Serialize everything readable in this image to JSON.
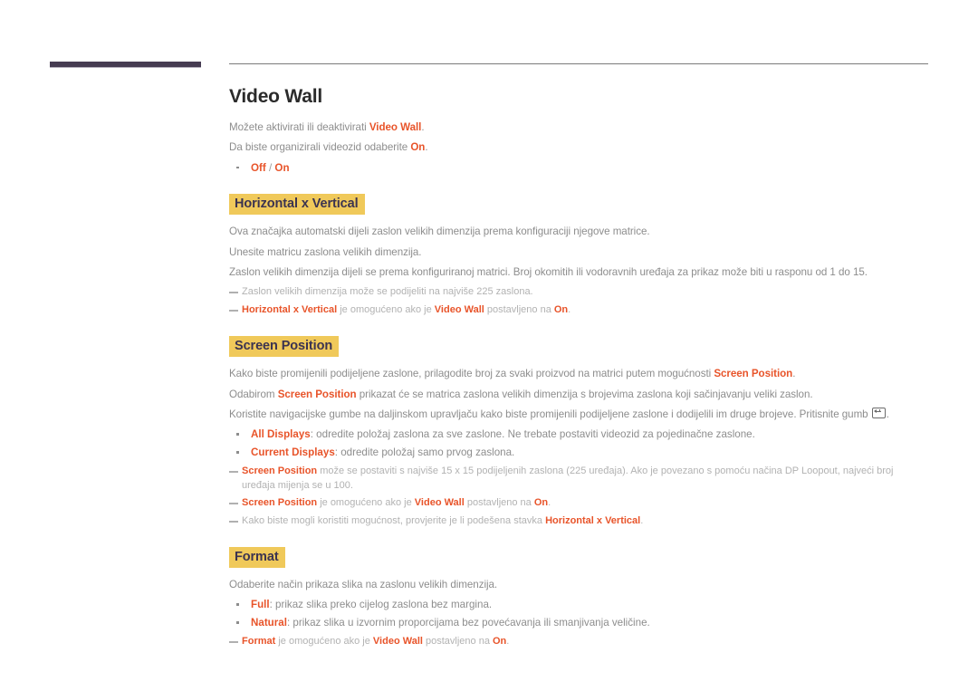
{
  "page": {
    "title": "Video Wall",
    "language": "hr"
  },
  "colors": {
    "tab_bar": "#463c52",
    "highlight": "#f0c95a",
    "keyword": "#e8542a",
    "body_text": "#8d8d8d",
    "note_text": "#b2b2b2",
    "title_text": "#2b2b2b",
    "rule": "#7b7b7b"
  },
  "sections": [
    {
      "id": "video-wall",
      "is_page_title": true,
      "heading": "Video Wall",
      "paragraphs": [
        {
          "pre": "Možete aktivirati ili deaktivirati ",
          "kw": "Video Wall",
          "post": "."
        },
        {
          "pre": "Da biste organizirali videozid odaberite ",
          "kw": "On",
          "post": "."
        }
      ],
      "options": [
        {
          "kw": "Off",
          "sep": " / ",
          "kw2": "On",
          "desc": ""
        }
      ],
      "notes": []
    },
    {
      "id": "horizontal-x-vertical",
      "is_page_title": false,
      "heading": "Horizontal x Vertical",
      "paragraphs": [
        {
          "pre": "Ova značajka automatski dijeli zaslon velikih dimenzija prema konfiguraciji njegove matrice.",
          "kw": "",
          "post": ""
        },
        {
          "pre": "Unesite matricu zaslona velikih dimenzija.",
          "kw": "",
          "post": ""
        },
        {
          "pre": "Zaslon velikih dimenzija dijeli se prema konfiguriranoj matrici. Broj okomitih ili vodoravnih uređaja za prikaz može biti u rasponu od 1 do 15.",
          "kw": "",
          "post": ""
        }
      ],
      "options": [],
      "notes": [
        {
          "parts": [
            {
              "t": "Zaslon velikih dimenzija može se podijeliti na najviše 225 zaslona.",
              "k": false
            }
          ]
        },
        {
          "parts": [
            {
              "t": "Horizontal x Vertical",
              "k": true
            },
            {
              "t": " je omogućeno ako je ",
              "k": false
            },
            {
              "t": "Video Wall",
              "k": true
            },
            {
              "t": " postavljeno na ",
              "k": false
            },
            {
              "t": "On",
              "k": true
            },
            {
              "t": ".",
              "k": false
            }
          ]
        }
      ]
    },
    {
      "id": "screen-position",
      "is_page_title": false,
      "heading": "Screen Position",
      "paragraphs": [
        {
          "pre": "Kako biste promijenili podijeljene zaslone, prilagodite broj za svaki proizvod na matrici putem mogućnosti ",
          "kw": "Screen Position",
          "post": "."
        },
        {
          "pre": "Odabirom ",
          "kw": "Screen Position",
          "post": " prikazat će se matrica zaslona velikih dimenzija s brojevima zaslona koji sačinjavanju veliki zaslon."
        },
        {
          "pre": "Koristite navigacijske gumbe na daljinskom upravljaču kako biste promijenili podijeljene zaslone i dodijelili im druge brojeve. Pritisnite gumb ",
          "kw": "",
          "post": ".",
          "enter_key": true
        }
      ],
      "options": [
        {
          "kw": "All Displays",
          "sep": "",
          "kw2": "",
          "desc": ": odredite položaj zaslona za sve zaslone. Ne trebate postaviti videozid za pojedinačne zaslone."
        },
        {
          "kw": "Current Displays",
          "sep": "",
          "kw2": "",
          "desc": ": odredite položaj samo prvog zaslona."
        }
      ],
      "notes": [
        {
          "parts": [
            {
              "t": "Screen Position",
              "k": true
            },
            {
              "t": " može se postaviti s najviše 15 x 15 podijeljenih zaslona (225 uređaja). Ako je povezano s pomoću načina DP Loopout, najveći broj uređaja mijenja se u 100.",
              "k": false
            }
          ]
        },
        {
          "parts": [
            {
              "t": "Screen Position",
              "k": true
            },
            {
              "t": " je omogućeno ako je ",
              "k": false
            },
            {
              "t": "Video Wall",
              "k": true
            },
            {
              "t": " postavljeno na ",
              "k": false
            },
            {
              "t": "On",
              "k": true
            },
            {
              "t": ".",
              "k": false
            }
          ]
        },
        {
          "parts": [
            {
              "t": "Kako biste mogli koristiti mogućnost, provjerite je li podešena stavka ",
              "k": false
            },
            {
              "t": "Horizontal x Vertical",
              "k": true
            },
            {
              "t": ".",
              "k": false
            }
          ]
        }
      ]
    },
    {
      "id": "format",
      "is_page_title": false,
      "heading": "Format",
      "paragraphs": [
        {
          "pre": "Odaberite način prikaza slika na zaslonu velikih dimenzija.",
          "kw": "",
          "post": ""
        }
      ],
      "options": [
        {
          "kw": "Full",
          "sep": "",
          "kw2": "",
          "desc": ": prikaz slika preko cijelog zaslona bez margina."
        },
        {
          "kw": "Natural",
          "sep": "",
          "kw2": "",
          "desc": ": prikaz slika u izvornim proporcijama bez povećavanja ili smanjivanja veličine."
        }
      ],
      "notes": [
        {
          "parts": [
            {
              "t": "Format",
              "k": true
            },
            {
              "t": " je omogućeno ako je ",
              "k": false
            },
            {
              "t": "Video Wall",
              "k": true
            },
            {
              "t": " postavljeno na ",
              "k": false
            },
            {
              "t": "On",
              "k": true
            },
            {
              "t": ".",
              "k": false
            }
          ]
        }
      ]
    }
  ]
}
